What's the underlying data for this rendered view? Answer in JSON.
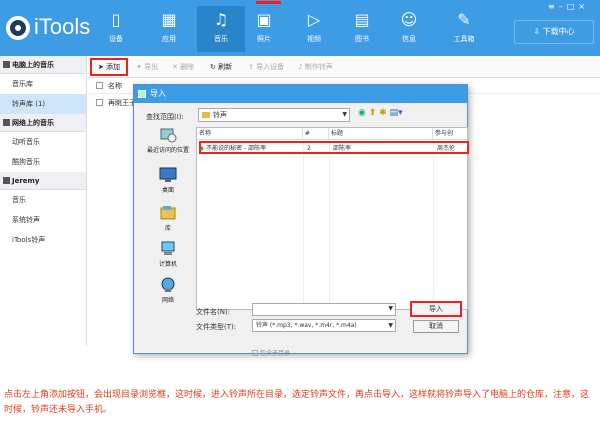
{
  "app": {
    "name": "iTools"
  },
  "nav": [
    {
      "label": "设备",
      "icon": "phone-icon"
    },
    {
      "label": "应用",
      "icon": "apps-icon"
    },
    {
      "label": "音乐",
      "icon": "music-icon"
    },
    {
      "label": "照片",
      "icon": "photo-icon"
    },
    {
      "label": "视频",
      "icon": "video-icon"
    },
    {
      "label": "图书",
      "icon": "book-icon"
    },
    {
      "label": "信息",
      "icon": "contact-icon"
    },
    {
      "label": "工具箱",
      "icon": "tools-icon"
    }
  ],
  "download_center": "下载中心",
  "sidebar": {
    "sections": [
      {
        "title": "电脑上的音乐",
        "items": [
          "音乐库",
          "铃声库 (1)"
        ]
      },
      {
        "title": "网络上的音乐",
        "items": [
          "动听音乐",
          "酷狗音乐"
        ]
      },
      {
        "title": "Jeremy",
        "items": [
          "音乐",
          "系统铃声",
          "iTools铃声"
        ]
      }
    ]
  },
  "toolbar": {
    "add": "添加",
    "export": "导出",
    "delete": "删除",
    "refresh": "刷新",
    "import_device": "导入设备",
    "make_ringtone": "制作铃声"
  },
  "list": {
    "header": "名称",
    "row": "再眺王子"
  },
  "dialog": {
    "title": "导入",
    "lookin_label": "查找范围(I):",
    "lookin_value": "铃声",
    "places": [
      "最近访问的位置",
      "桌面",
      "库",
      "计算机",
      "网络"
    ],
    "columns": [
      "名称",
      "#",
      "标题",
      "参与创"
    ],
    "file": {
      "name": "不能说的秘密 - 邵陈率",
      "num": "2",
      "title": "邵陈率",
      "artist": "周杰伦"
    },
    "filename_label": "文件名(N):",
    "filetype_label": "文件类型(T):",
    "filetype_value": "铃声 (*.mp3, *.wav, *.m4r, *.m4a)",
    "import_btn": "导入",
    "cancel_btn": "取消",
    "subdir": "包含子目录"
  },
  "tip": "点击左上角添加按钮，会出现目录浏览框，这时候，进入铃声所在目录，选定铃声文件，再点击导入，这样就将铃声导入了电脑上的仓库，注意，这时候，铃声还未导入手机。"
}
